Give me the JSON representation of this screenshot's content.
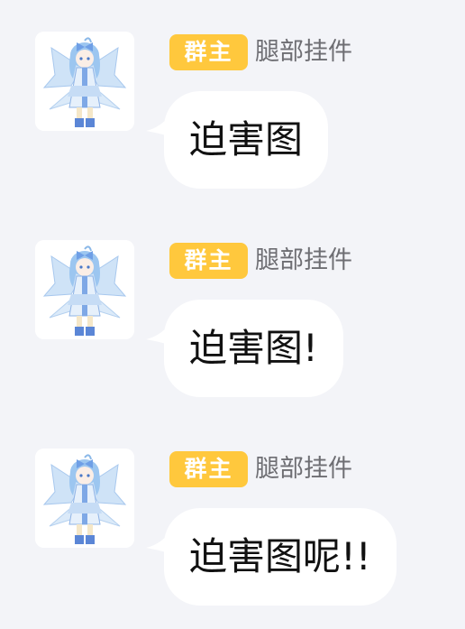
{
  "colors": {
    "background": "#f3f4f8",
    "badge": "#ffc83d",
    "bubble": "#ffffff",
    "sender_text": "#6e6e73",
    "message_text": "#111111"
  },
  "messages": [
    {
      "badge": "群主",
      "sender": "腿部挂件",
      "text": "迫害图",
      "avatar_icon": "anime-girl-avatar-icon"
    },
    {
      "badge": "群主",
      "sender": "腿部挂件",
      "text": "迫害图!",
      "avatar_icon": "anime-girl-avatar-icon"
    },
    {
      "badge": "群主",
      "sender": "腿部挂件",
      "text": "迫害图呢!!",
      "avatar_icon": "anime-girl-avatar-icon"
    }
  ]
}
